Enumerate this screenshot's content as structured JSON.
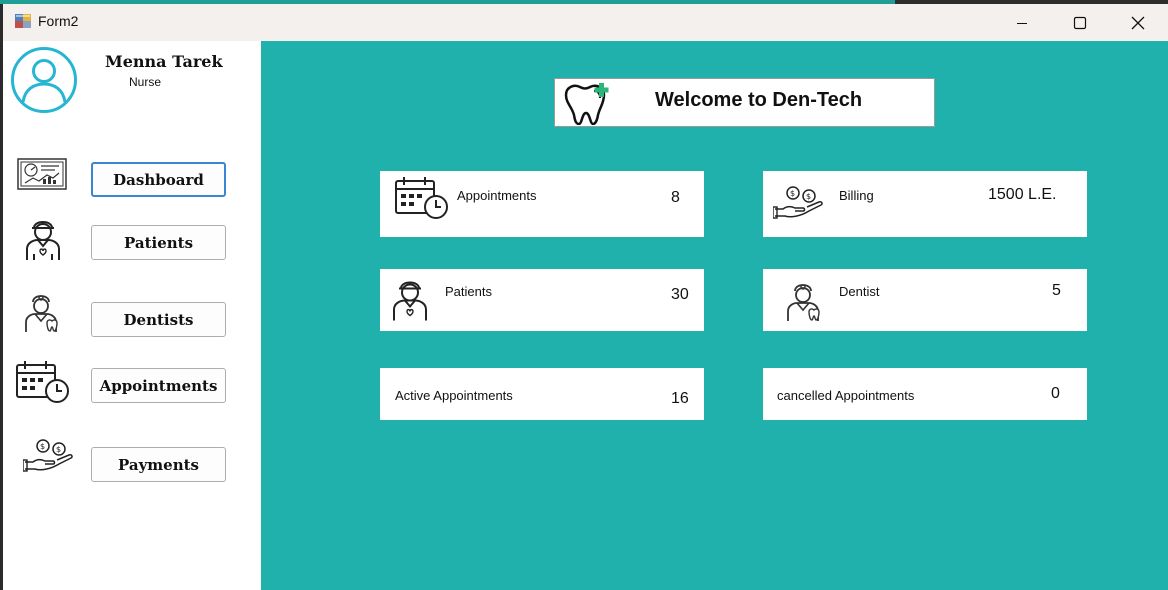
{
  "window": {
    "title": "Form2"
  },
  "user": {
    "name": "Menna Tarek",
    "role": "Nurse"
  },
  "nav": {
    "dashboard": "Dashboard",
    "patients": "Patients",
    "dentists": "Dentists",
    "appointments": "Appointments",
    "payments": "Payments"
  },
  "welcome": "Welcome to Den-Tech",
  "stats": {
    "appointments": {
      "label": "Appointments",
      "value": "8"
    },
    "billing": {
      "label": "Billing",
      "value": "1500 L.E."
    },
    "patients": {
      "label": "Patients",
      "value": "30"
    },
    "dentist": {
      "label": "Dentist",
      "value": "5"
    },
    "active": {
      "label": "Active Appointments",
      "value": "16"
    },
    "cancelled": {
      "label": "cancelled Appointments",
      "value": "0"
    }
  },
  "colors": {
    "accent": "#21b1ac",
    "active_border": "#3a86d0",
    "avatar": "#27b5d4"
  }
}
